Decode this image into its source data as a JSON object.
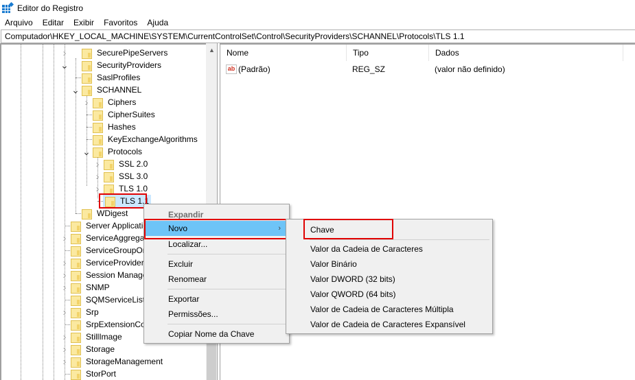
{
  "window": {
    "title": "Editor do Registro",
    "icon": "registry-editor-icon"
  },
  "menubar": {
    "items": [
      "Arquivo",
      "Editar",
      "Exibir",
      "Favoritos",
      "Ajuda"
    ]
  },
  "address": {
    "path": "Computador\\HKEY_LOCAL_MACHINE\\SYSTEM\\CurrentControlSet\\Control\\SecurityProviders\\SCHANNEL\\Protocols\\TLS 1.1"
  },
  "tree": {
    "items": [
      {
        "label": "SecurePipeServers",
        "level": 0,
        "expander": "collapsed"
      },
      {
        "label": "SecurityProviders",
        "level": 0,
        "expander": "expanded"
      },
      {
        "label": "SaslProfiles",
        "level": 1,
        "expander": "none"
      },
      {
        "label": "SCHANNEL",
        "level": 1,
        "expander": "expanded"
      },
      {
        "label": "Ciphers",
        "level": 2,
        "expander": "collapsed"
      },
      {
        "label": "CipherSuites",
        "level": 2,
        "expander": "none"
      },
      {
        "label": "Hashes",
        "level": 2,
        "expander": "none"
      },
      {
        "label": "KeyExchangeAlgorithms",
        "level": 2,
        "expander": "none"
      },
      {
        "label": "Protocols",
        "level": 2,
        "expander": "expanded"
      },
      {
        "label": "SSL 2.0",
        "level": 3,
        "expander": "collapsed"
      },
      {
        "label": "SSL 3.0",
        "level": 3,
        "expander": "collapsed"
      },
      {
        "label": "TLS 1.0",
        "level": 3,
        "expander": "collapsed"
      },
      {
        "label": "TLS 1.1",
        "level": 3,
        "expander": "none",
        "selected": true
      },
      {
        "label": "WDigest",
        "level": 1,
        "expander": "none"
      },
      {
        "label": "Server Applicatio",
        "level": -1,
        "expander": "none"
      },
      {
        "label": "ServiceAggregat",
        "level": -1,
        "expander": "collapsed"
      },
      {
        "label": "ServiceGroupOrc",
        "level": -1,
        "expander": "none"
      },
      {
        "label": "ServiceProvider",
        "level": -1,
        "expander": "collapsed"
      },
      {
        "label": "Session Manager",
        "level": -1,
        "expander": "collapsed"
      },
      {
        "label": "SNMP",
        "level": -1,
        "expander": "collapsed"
      },
      {
        "label": "SQMServiceList",
        "level": -1,
        "expander": "none"
      },
      {
        "label": "Srp",
        "level": -1,
        "expander": "collapsed"
      },
      {
        "label": "SrpExtensionCor",
        "level": -1,
        "expander": "none"
      },
      {
        "label": "StillImage",
        "level": -1,
        "expander": "collapsed"
      },
      {
        "label": "Storage",
        "level": -1,
        "expander": "collapsed"
      },
      {
        "label": "StorageManagement",
        "level": -1,
        "expander": "collapsed"
      },
      {
        "label": "StorPort",
        "level": -1,
        "expander": "none"
      }
    ]
  },
  "list": {
    "columns": [
      "Nome",
      "Tipo",
      "Dados"
    ],
    "rows": [
      {
        "name": "(Padrão)",
        "type": "REG_SZ",
        "data": "(valor não definido)",
        "icon": "string-value-icon"
      }
    ]
  },
  "context_menu": {
    "items": [
      {
        "label": "Expandir",
        "bold": true
      },
      {
        "label": "Novo",
        "highlighted": true,
        "submenu": true
      },
      {
        "label": "Localizar..."
      },
      {
        "separator": true
      },
      {
        "label": "Excluir"
      },
      {
        "label": "Renomear"
      },
      {
        "separator": true
      },
      {
        "label": "Exportar"
      },
      {
        "label": "Permissões..."
      },
      {
        "separator": true
      },
      {
        "label": "Copiar Nome da Chave"
      }
    ],
    "submenu_arrow": "›"
  },
  "submenu": {
    "items": [
      {
        "label": "Chave",
        "annotated": true
      },
      {
        "separator": true
      },
      {
        "label": "Valor da Cadeia de Caracteres"
      },
      {
        "label": "Valor Binário"
      },
      {
        "label": "Valor DWORD (32 bits)"
      },
      {
        "label": "Valor QWORD (64 bits)"
      },
      {
        "label": "Valor de Cadeia de Caracteres Múltipla"
      },
      {
        "label": "Valor de Cadeia de Caracteres Expansível"
      }
    ]
  },
  "colors": {
    "highlight": "#6ec4f7",
    "selection": "#cce8ff",
    "annotation": "#e00000",
    "folder": "#fbe9a0"
  }
}
